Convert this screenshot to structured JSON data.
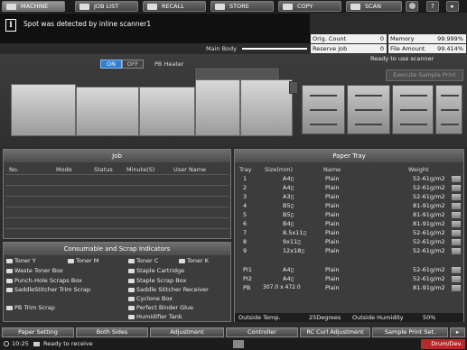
{
  "tabs": [
    "MACHINE",
    "JOB LIST",
    "RECALL",
    "STORE",
    "COPY",
    "SCAN"
  ],
  "corner_buttons": [
    "?",
    "▸"
  ],
  "message": "Spot was detected by inline scanner1",
  "main_body_label": "Main Body",
  "counters": {
    "orig_count_label": "Orig. Count",
    "orig_count_value": "0",
    "memory_label": "Memory",
    "memory_value": "99.999%",
    "reserve_job_label": "Reserve Job",
    "reserve_job_value": "0",
    "file_amount_label": "File Amount",
    "file_amount_value": "99.414%"
  },
  "machine_status": "Ready to use scanner",
  "execute_sample_print": "Execute Sample Print",
  "pb_heater": {
    "on": "ON",
    "off": "OFF",
    "label": "PB Heater"
  },
  "job": {
    "title": "Job",
    "columns": [
      "No.",
      "Mode",
      "Status",
      "Minute(S)",
      "User Name"
    ]
  },
  "consumables": {
    "title": "Consumable and Scrap Indicators",
    "items": [
      "Toner Y",
      "Toner M",
      "Toner C",
      "Toner K",
      "Waste Toner Box",
      "Staple Cartridge",
      "Punch-Hole Scraps Box",
      "Staple Scrap Box",
      "SaddleStitcher Trim Scrap",
      "Saddle Stitcher Receiver",
      "Cyclone Box",
      "PB Trim Scrap",
      "Perfect Binder Glue",
      "Humidifier Tank"
    ]
  },
  "paper_tray": {
    "title": "Paper Tray",
    "columns": [
      "Tray",
      "Size(mm)",
      "Name",
      "Weight"
    ],
    "rows": [
      {
        "tray": "1",
        "size": "A4▯",
        "name": "Plain",
        "weight": "52-61g/m2"
      },
      {
        "tray": "2",
        "size": "A4▯",
        "name": "Plain",
        "weight": "52-61g/m2"
      },
      {
        "tray": "3",
        "size": "A3▯",
        "name": "Plain",
        "weight": "52-61g/m2"
      },
      {
        "tray": "4",
        "size": "B5▯",
        "name": "Plain",
        "weight": "81-91g/m2"
      },
      {
        "tray": "5",
        "size": "B5▯",
        "name": "Plain",
        "weight": "81-91g/m2"
      },
      {
        "tray": "6",
        "size": "B4▯",
        "name": "Plain",
        "weight": "81-91g/m2"
      },
      {
        "tray": "7",
        "size": "8.5x11▯",
        "name": "Plain",
        "weight": "52-61g/m2"
      },
      {
        "tray": "8",
        "size": "9x11▯",
        "name": "Plain",
        "weight": "52-61g/m2"
      },
      {
        "tray": "9",
        "size": "12x18▯",
        "name": "Plain",
        "weight": "52-61g/m2"
      },
      {
        "tray": "PI1",
        "size": "A4▯",
        "name": "Plain",
        "weight": "52-61g/m2"
      },
      {
        "tray": "PI2",
        "size": "A4▯",
        "name": "Plain",
        "weight": "52-61g/m2"
      },
      {
        "tray": "PB",
        "size": "307.0 x 472.0",
        "name": "Plain",
        "weight": "81-91g/m2"
      }
    ],
    "outside_temp_label": "Outside Temp.",
    "outside_temp_value": "25Degrees",
    "outside_humidity_label": "Outside Humidity",
    "outside_humidity_value": "50%"
  },
  "bottom_tabs": [
    "Paper Setting",
    "Both Sides",
    "Adjustment",
    "Controller",
    "RC Curl Adjustment",
    "Sample Print Set.",
    "▸"
  ],
  "statusbar": {
    "time": "10:25",
    "status": "Ready to receive",
    "right_label": "Drum/Dev."
  }
}
